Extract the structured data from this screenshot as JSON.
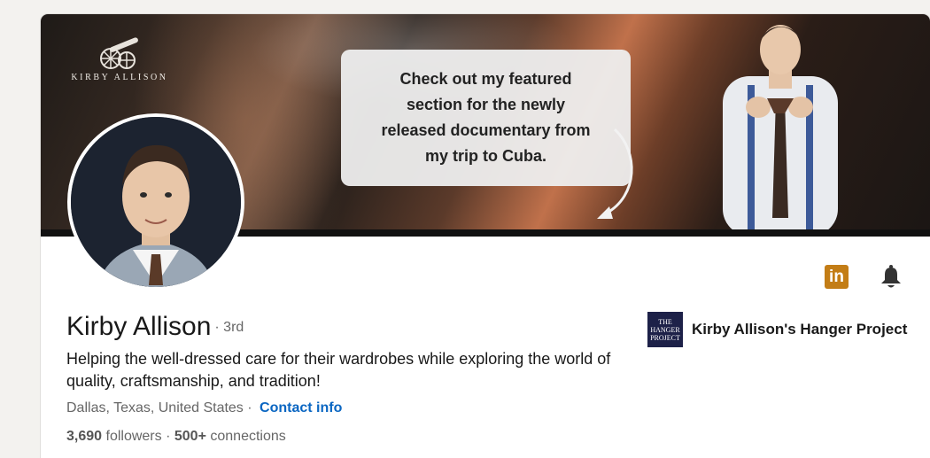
{
  "banner": {
    "logo_text": "KIRBY ALLISON",
    "speech_text": "Check out my featured\nsection for the newly\nreleased documentary from\nmy trip to Cuba."
  },
  "profile": {
    "name": "Kirby Allison",
    "degree": "· 3rd",
    "headline": "Helping the well-dressed care for their wardrobes while exploring the world of quality, craftsmanship, and tradition!",
    "location": "Dallas, Texas, United States ·",
    "contact_label": "Contact info",
    "followers": "3,690",
    "followers_label": "followers",
    "connections_sep": "·",
    "connections": "500+",
    "connections_label": "connections"
  },
  "actions": {
    "linkedin_icon": "linkedin-icon",
    "linkedin_text": "in",
    "bell_icon": "bell-icon"
  },
  "company": {
    "logo_line1": "THE",
    "logo_line2": "HANGER",
    "logo_line3": "PROJECT",
    "name": "Kirby Allison's Hanger Project"
  },
  "colors": {
    "link": "#0a66c2",
    "linkedin_badge": "#c37d16",
    "company_logo_bg": "#1d2148"
  }
}
